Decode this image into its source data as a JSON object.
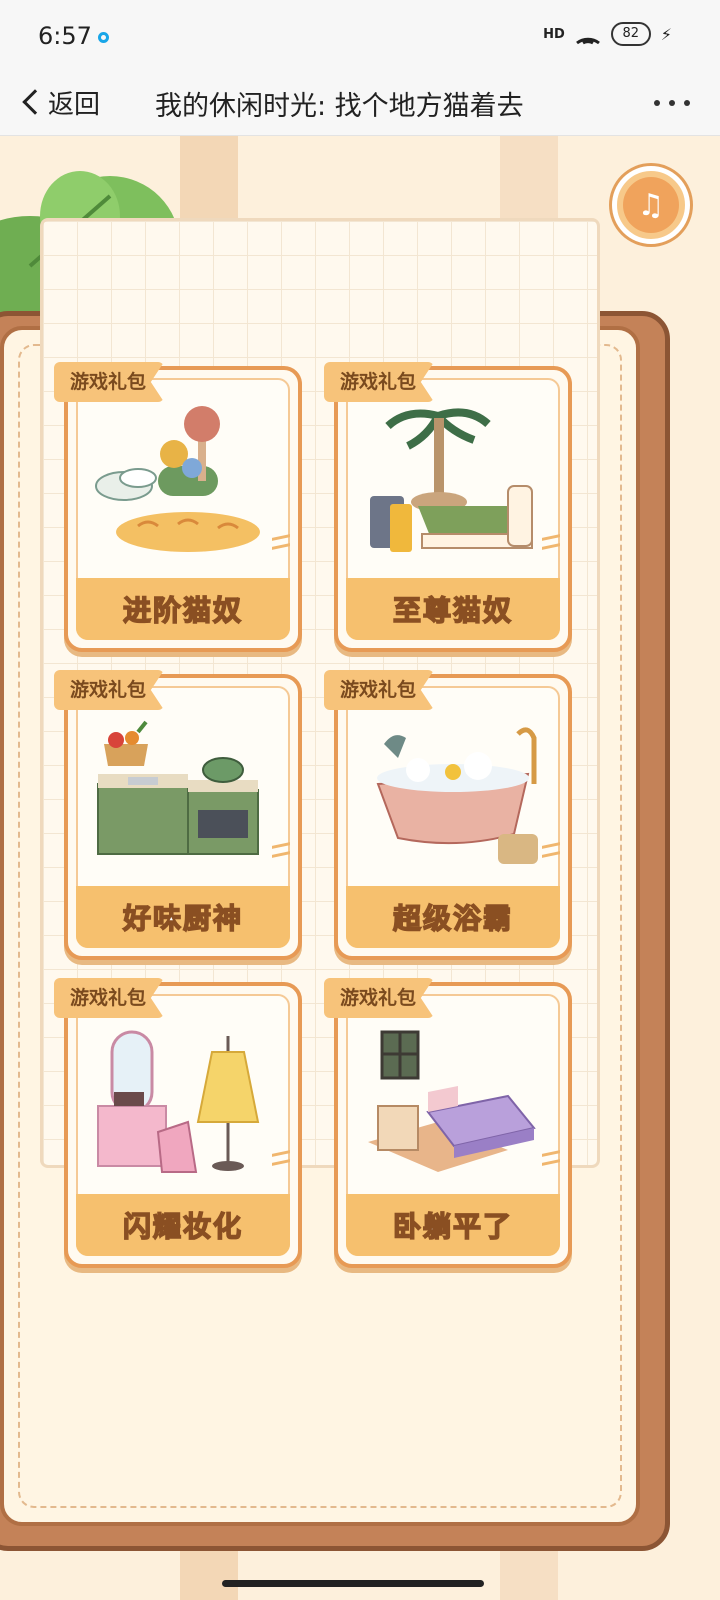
{
  "status_bar": {
    "time": "6:57",
    "signal": "HD",
    "battery": "82"
  },
  "nav": {
    "back_label": "返回",
    "title": "我的休闲时光: 找个地方猫着去"
  },
  "icons": {
    "music": "music-note-icon",
    "share": "share-arrow-icon",
    "more": "more-dots-icon"
  },
  "colors": {
    "accent": "#f6c06e",
    "card_border": "#e79a55",
    "book": "#c48258",
    "share": "#5b8dd8"
  },
  "gift_packs": [
    {
      "tag": "游戏礼包",
      "name": "进阶猫奴"
    },
    {
      "tag": "游戏礼包",
      "name": "至尊猫奴"
    },
    {
      "tag": "游戏礼包",
      "name": "好味厨神"
    },
    {
      "tag": "游戏礼包",
      "name": "超级浴霸"
    },
    {
      "tag": "游戏礼包",
      "name": "闪耀妆化"
    },
    {
      "tag": "游戏礼包",
      "name": "卧躺平了"
    }
  ]
}
